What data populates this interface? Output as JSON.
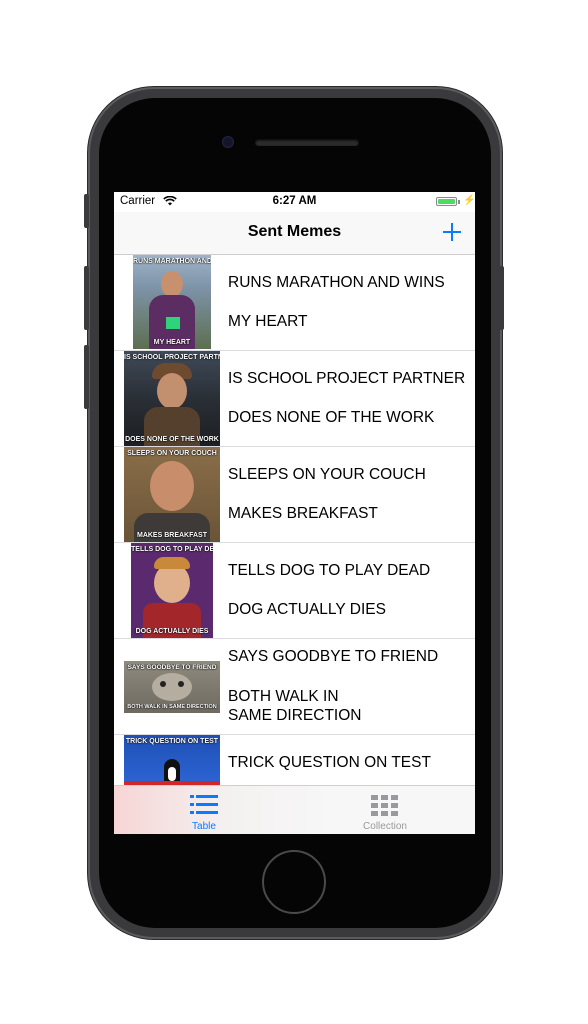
{
  "status_bar": {
    "carrier": "Carrier",
    "time": "6:27 AM",
    "wifi_icon": "wifi-icon",
    "battery_icon": "battery-icon",
    "charging_icon": "bolt-icon",
    "battery_color": "#4cd964"
  },
  "nav": {
    "title": "Sent Memes",
    "add_icon": "plus-icon",
    "accent": "#0a7aff"
  },
  "memes": [
    {
      "top_text": "RUNS MARATHON AND WINS",
      "bottom_text": "MY HEART",
      "thumb_top": "RUNS MARATHON AND WINS",
      "thumb_bottom": "MY HEART"
    },
    {
      "top_text": "IS SCHOOL PROJECT PARTNER",
      "bottom_text": "DOES NONE OF THE WORK",
      "thumb_top": "IS SCHOOL PROJECT PARTNER",
      "thumb_bottom": "DOES NONE OF THE WORK"
    },
    {
      "top_text": "SLEEPS ON YOUR COUCH",
      "bottom_text": "MAKES BREAKFAST",
      "thumb_top": "SLEEPS ON YOUR COUCH",
      "thumb_bottom": "MAKES BREAKFAST"
    },
    {
      "top_text": "TELLS DOG TO PLAY DEAD",
      "bottom_text": "DOG ACTUALLY DIES",
      "thumb_top": "TELLS DOG TO PLAY DEAD",
      "thumb_bottom": "DOG ACTUALLY DIES"
    },
    {
      "top_text": "SAYS GOODBYE TO FRIEND",
      "bottom_text": "BOTH WALK IN\nSAME DIRECTION",
      "thumb_top": "SAYS GOODBYE TO FRIEND",
      "thumb_bottom": "BOTH WALK IN SAME DIRECTION"
    },
    {
      "top_text": "TRICK QUESTION ON TEST",
      "bottom_text": "",
      "thumb_top": "TRICK QUESTION ON TEST",
      "thumb_bottom": ""
    }
  ],
  "tabs": [
    {
      "label": "Table",
      "icon": "list-icon",
      "selected": true,
      "color": "#0a7aff"
    },
    {
      "label": "Collection",
      "icon": "grid-icon",
      "selected": false,
      "color": "#9a9a9e"
    }
  ]
}
